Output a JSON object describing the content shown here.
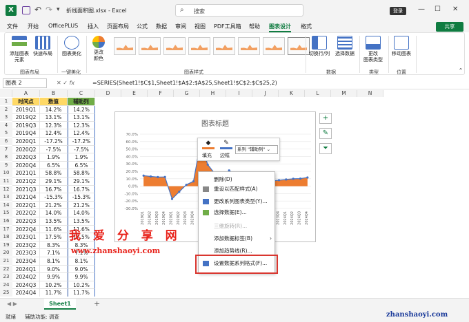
{
  "app": {
    "document_title": "折线面积图.xlsx - Excel",
    "search_placeholder": "搜索",
    "login_label": "登录",
    "share_label": "共享"
  },
  "tabs": [
    "文件",
    "开始",
    "OfficePLUS",
    "插入",
    "页面布局",
    "公式",
    "数据",
    "审阅",
    "视图",
    "PDF工具箱",
    "帮助",
    "图表设计",
    "格式"
  ],
  "active_tab": "图表设计",
  "ribbon": {
    "add_element": "添加图表\n元素",
    "quick_layout": "快速布局",
    "group_layout": "图表布局",
    "beautify": "图表美化",
    "group_beautify": "一键美化",
    "change_colors": "更改\n颜色",
    "group_styles": "图表样式",
    "switch_row_col": "切换行/列",
    "select_data": "选择数据",
    "group_data": "数据",
    "change_type": "更改\n图表类型",
    "group_type": "类型",
    "move_chart": "移动图表",
    "group_location": "位置"
  },
  "formula_bar": {
    "name_box": "图表 2",
    "fx": "fx",
    "formula": "=SERIES(Sheet1!$C$1,Sheet1!$A$2:$A$25,Sheet1!$C$2:$C$25,2)"
  },
  "columns": [
    "A",
    "B",
    "C",
    "D",
    "E",
    "F",
    "G",
    "H",
    "I",
    "J",
    "K",
    "L",
    "M",
    "N"
  ],
  "table": {
    "headers": [
      "时间点",
      "数值",
      "辅助列"
    ],
    "rows": [
      [
        "2019Q1",
        "14.2%",
        "14.2%"
      ],
      [
        "2019Q2",
        "13.1%",
        "13.1%"
      ],
      [
        "2019Q3",
        "12.3%",
        "12.3%"
      ],
      [
        "2019Q4",
        "12.4%",
        "12.4%"
      ],
      [
        "2020Q1",
        "-17.2%",
        "-17.2%"
      ],
      [
        "2020Q2",
        "-7.5%",
        "-7.5%"
      ],
      [
        "2020Q3",
        "1.9%",
        "1.9%"
      ],
      [
        "2020Q4",
        "6.5%",
        "6.5%"
      ],
      [
        "2021Q1",
        "58.8%",
        "58.8%"
      ],
      [
        "2021Q2",
        "29.1%",
        "29.1%"
      ],
      [
        "2021Q3",
        "16.7%",
        "16.7%"
      ],
      [
        "2021Q4",
        "-15.3%",
        "-15.3%"
      ],
      [
        "2022Q1",
        "21.2%",
        "21.2%"
      ],
      [
        "2022Q2",
        "14.0%",
        "14.0%"
      ],
      [
        "2022Q3",
        "13.5%",
        "13.5%"
      ],
      [
        "2022Q4",
        "11.6%",
        "11.6%"
      ],
      [
        "2023Q1",
        "17.5%",
        "17.5%"
      ],
      [
        "2023Q2",
        "8.3%",
        "8.3%"
      ],
      [
        "2023Q3",
        "7.1%",
        "7.1%"
      ],
      [
        "2023Q4",
        "8.1%",
        "8.1%"
      ],
      [
        "2024Q1",
        "9.0%",
        "9.0%"
      ],
      [
        "2024Q2",
        "9.9%",
        "9.9%"
      ],
      [
        "2024Q3",
        "10.2%",
        "10.2%"
      ],
      [
        "2024Q4",
        "11.7%",
        "11.7%"
      ]
    ]
  },
  "chart_data": {
    "type": "area",
    "title": "图表标题",
    "categories": [
      "2019Q1",
      "2019Q2",
      "2019Q3",
      "2019Q4",
      "2020Q1",
      "2020Q2",
      "2020Q3",
      "2020Q4",
      "2021Q1",
      "2021Q2",
      "2021Q3",
      "2021Q4",
      "2022Q1",
      "2022Q2",
      "2022Q3",
      "2022Q4",
      "2023Q1",
      "2023Q2",
      "2023Q3",
      "2023Q4",
      "2024Q1",
      "2024Q2",
      "2024Q3",
      "2024Q4"
    ],
    "series": [
      {
        "name": "数值",
        "values": [
          14.2,
          13.1,
          12.3,
          12.4,
          -17.2,
          -7.5,
          1.9,
          6.5,
          58.8,
          29.1,
          16.7,
          -15.3,
          21.2,
          14.0,
          13.5,
          11.6,
          17.5,
          8.3,
          7.1,
          8.1,
          9.0,
          9.9,
          10.2,
          11.7
        ],
        "color": "#ed7d31"
      },
      {
        "name": "辅助列",
        "values": [
          14.2,
          13.1,
          12.3,
          12.4,
          -17.2,
          -7.5,
          1.9,
          6.5,
          58.8,
          29.1,
          16.7,
          -15.3,
          21.2,
          14.0,
          13.5,
          11.6,
          17.5,
          8.3,
          7.1,
          8.1,
          9.0,
          9.9,
          10.2,
          11.7
        ],
        "color": "#4472c4"
      }
    ],
    "yticks": [
      "70.0%",
      "60.0%",
      "50.0%",
      "40.0%",
      "30.0%",
      "20.0%",
      "10.0%",
      "0.0%",
      "-10.0%",
      "-20.0%",
      "-30.0%"
    ],
    "ylim": [
      -30,
      70
    ]
  },
  "mini_toolbar": {
    "fill": "填充",
    "border": "边框",
    "series_select": "系列 \"辅助列\""
  },
  "context_menu": [
    {
      "label": "删除(D)",
      "disabled": false
    },
    {
      "label": "重设以匹配样式(A)",
      "disabled": false
    },
    {
      "label": "更改系列图表类型(Y)...",
      "disabled": false
    },
    {
      "label": "选择数据(E)...",
      "disabled": false
    },
    {
      "label": "三维旋转(R)...",
      "disabled": true
    },
    {
      "label": "添加数据标签(B)",
      "disabled": false
    },
    {
      "label": "添加趋势线(R)...",
      "disabled": false
    },
    {
      "label": "设置数据系列格式(F)...",
      "disabled": false
    }
  ],
  "watermark": {
    "cn": "我 爱 分 享 网",
    "url": "www.zhanshaoyi.com",
    "url2": "zhanshaoyi.com"
  },
  "sheet_tab": "Sheet1",
  "status": {
    "ready": "就绪",
    "accessibility": "辅助功能: 调查"
  },
  "colors": {
    "accent": "#107c41",
    "area": "#ed7d31",
    "line": "#4472c4",
    "highlight": "#d9362f"
  }
}
